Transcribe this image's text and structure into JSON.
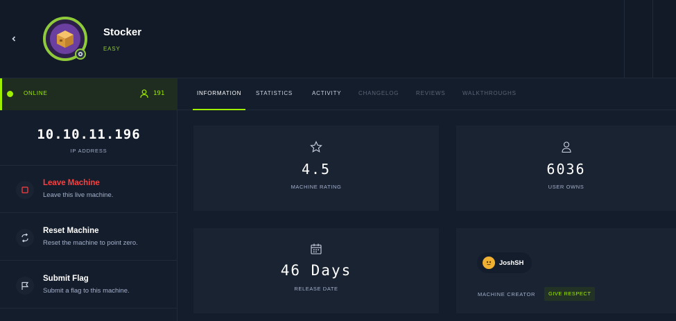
{
  "machine": {
    "name": "Stocker",
    "difficulty": "EASY"
  },
  "status": {
    "state": "ONLINE",
    "users_count": "191"
  },
  "connection": {
    "ip": "10.10.11.196",
    "ip_label": "IP ADDRESS"
  },
  "actions": [
    {
      "title": "Leave Machine",
      "subtitle": "Leave this live machine."
    },
    {
      "title": "Reset Machine",
      "subtitle": "Reset the machine to point zero."
    },
    {
      "title": "Submit Flag",
      "subtitle": "Submit a flag to this machine."
    }
  ],
  "tabs": [
    {
      "label": "INFORMATION",
      "state": "active"
    },
    {
      "label": "STATISTICS",
      "state": "enabled"
    },
    {
      "label": "ACTIVITY",
      "state": "enabled"
    },
    {
      "label": "CHANGELOG",
      "state": "dimmed"
    },
    {
      "label": "REVIEWS",
      "state": "dimmed"
    },
    {
      "label": "WALKTHROUGHS",
      "state": "dimmed"
    }
  ],
  "stats": {
    "rating": {
      "value": "4.5",
      "label": "MACHINE RATING",
      "icon": "star-icon"
    },
    "owns": {
      "value": "6036",
      "label": "USER OWNS",
      "icon": "user-icon"
    },
    "release": {
      "value": "46 Days",
      "label": "RELEASE DATE",
      "icon": "calendar-icon"
    }
  },
  "creator": {
    "name": "JoshSH",
    "label": "MACHINE CREATOR",
    "respect_label": "GIVE RESPECT"
  },
  "colors": {
    "background": "#141d2b",
    "card": "#1a2332",
    "accent_green": "#9fef00",
    "danger_red": "#ff3e3e",
    "muted_text": "#a4b1cd"
  }
}
